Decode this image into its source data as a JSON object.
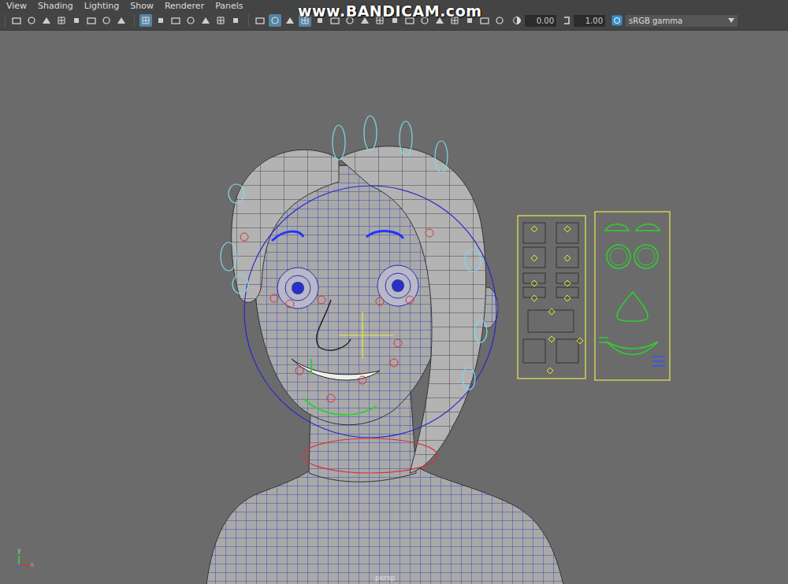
{
  "menu": [
    {
      "label": "View"
    },
    {
      "label": "Shading"
    },
    {
      "label": "Lighting"
    },
    {
      "label": "Show"
    },
    {
      "label": "Renderer"
    },
    {
      "label": "Panels"
    }
  ],
  "toolbar": {
    "groups": [
      [
        {
          "selected": false
        },
        {
          "selected": false
        },
        {
          "selected": false
        },
        {
          "selected": false
        },
        {
          "selected": false
        },
        {
          "selected": false
        },
        {
          "selected": false
        },
        {
          "selected": false
        }
      ],
      [
        {
          "selected": true
        },
        {
          "selected": false
        },
        {
          "selected": false
        },
        {
          "selected": false
        },
        {
          "selected": false
        },
        {
          "selected": false
        },
        {
          "selected": false
        }
      ],
      [
        {
          "selected": false
        },
        {
          "selected": true
        },
        {
          "selected": false
        },
        {
          "selected": true
        },
        {
          "selected": false
        },
        {
          "selected": false
        },
        {
          "selected": false
        },
        {
          "selected": false
        },
        {
          "selected": false
        },
        {
          "selected": false
        },
        {
          "selected": false
        },
        {
          "selected": false
        },
        {
          "selected": false
        },
        {
          "selected": false
        },
        {
          "selected": false
        },
        {
          "selected": false
        },
        {
          "selected": false
        }
      ]
    ],
    "exposure": "0.00",
    "gamma": "1.00",
    "color_space": "sRGB gamma"
  },
  "watermark": "www.BANDICAM.com",
  "viewport": {
    "camera": "persp",
    "axes": [
      "y",
      "x"
    ]
  }
}
